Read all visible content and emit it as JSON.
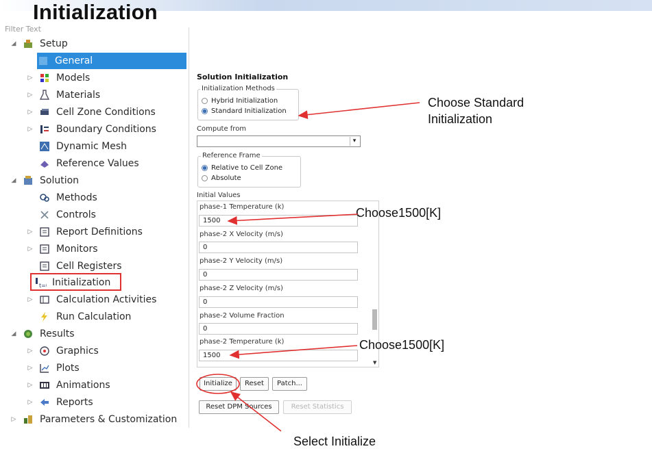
{
  "slide": {
    "title": "Initialization",
    "filter_placeholder": "Filter Text"
  },
  "tree": {
    "setup": "Setup",
    "general": "General",
    "models": "Models",
    "materials": "Materials",
    "cell_zone": "Cell Zone Conditions",
    "boundary": "Boundary Conditions",
    "dynamic_mesh": "Dynamic Mesh",
    "reference_values": "Reference Values",
    "solution": "Solution",
    "methods": "Methods",
    "controls": "Controls",
    "report_definitions": "Report Definitions",
    "monitors": "Monitors",
    "cell_registers": "Cell Registers",
    "initialization": "Initialization",
    "calc_activities": "Calculation Activities",
    "run_calc": "Run Calculation",
    "results": "Results",
    "graphics": "Graphics",
    "plots": "Plots",
    "animations": "Animations",
    "reports": "Reports",
    "parameters": "Parameters & Customization"
  },
  "panel": {
    "title": "Solution Initialization",
    "methods_group": "Initialization Methods",
    "hybrid": "Hybrid Initialization",
    "standard": "Standard Initialization",
    "compute_from": "Compute from",
    "compute_value": "",
    "ref_frame_group": "Reference Frame",
    "relative": "Relative to Cell Zone",
    "absolute": "Absolute",
    "initial_values": "Initial Values",
    "fields": [
      {
        "label": "phase-1 Temperature (k)",
        "value": "1500"
      },
      {
        "label": "phase-2 X Velocity (m/s)",
        "value": "0"
      },
      {
        "label": "phase-2 Y Velocity (m/s)",
        "value": "0"
      },
      {
        "label": "phase-2 Z Velocity (m/s)",
        "value": "0"
      },
      {
        "label": "phase-2 Volume Fraction",
        "value": "0"
      },
      {
        "label": "phase-2 Temperature (k)",
        "value": "1500"
      }
    ],
    "btn_initialize": "Initialize",
    "btn_reset": "Reset",
    "btn_patch": "Patch...",
    "btn_reset_dpm": "Reset DPM Sources",
    "btn_reset_stats": "Reset Statistics"
  },
  "annotations": {
    "choose_standard_1": "Choose Standard",
    "choose_standard_2": "Initialization",
    "choose_temp_1": "Choose1500[K]",
    "choose_temp_2": "Choose1500[K]",
    "select_initialize": "Select Initialize"
  },
  "colors": {
    "selection": "#2a8cdb",
    "annotation_red": "#e03030"
  }
}
